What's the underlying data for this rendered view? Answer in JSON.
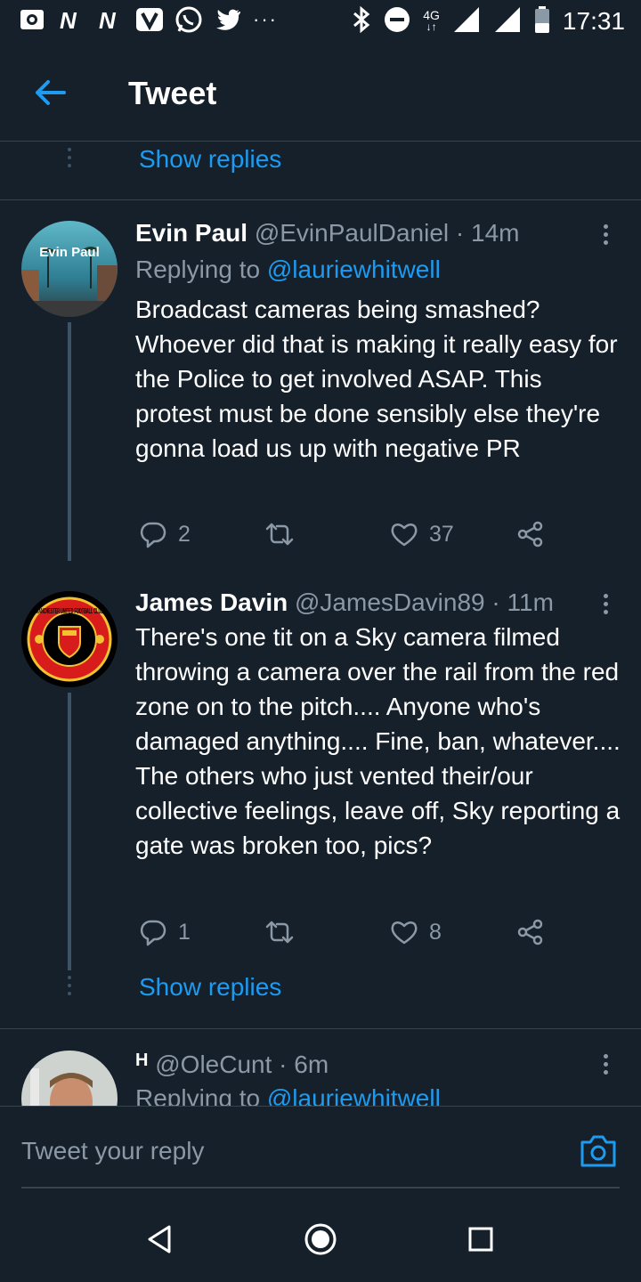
{
  "status_bar": {
    "time": "17:31",
    "network": "4G",
    "left_icons": [
      "notification-icon",
      "n-app-icon",
      "n-app-icon",
      "v-app-icon",
      "whatsapp-icon",
      "twitter-icon"
    ],
    "right_icons": [
      "bluetooth-icon",
      "dnd-icon",
      "signal-icon",
      "signal-icon",
      "battery-icon"
    ]
  },
  "topbar": {
    "title": "Tweet"
  },
  "show_replies_top": "Show replies",
  "tweets": [
    {
      "avatar_text": "Evin Paul",
      "name": "Evin Paul",
      "handle": "@EvinPaulDaniel",
      "time": "· 14m",
      "replying_prefix": "Replying to",
      "replying_link": "@lauriewhitwell",
      "text": "Broadcast cameras being smashed? Whoever did that is making it really easy for the Police to get involved ASAP. This protest must be done sensibly else they're gonna load us up with negative PR",
      "replies": "2",
      "retweets": "",
      "likes": "37"
    },
    {
      "avatar_text": "MANCHESTER UNITED FOOTBALL CLUB",
      "name": "James Davin",
      "handle": "@JamesDavin89",
      "time": "· 11m",
      "text": "There's one tit on a Sky camera filmed throwing a camera over the rail from the red zone on to the pitch.... Anyone who's damaged anything.... Fine, ban, whatever.... The others who just vented their/our collective feelings, leave off, Sky reporting a gate was broken too, pics?",
      "replies": "1",
      "retweets": "",
      "likes": "8"
    },
    {
      "name": "H",
      "handle": "@OleCunt",
      "time": "· 6m",
      "replying_prefix": "Replying to",
      "replying_link": "@lauriewhitwell"
    }
  ],
  "show_replies_bottom": "Show replies",
  "composer": {
    "placeholder": "Tweet your reply"
  },
  "colors": {
    "background": "#15202b",
    "accent": "#1d9bf0",
    "muted": "#8b98a5",
    "divider": "#38444d"
  }
}
